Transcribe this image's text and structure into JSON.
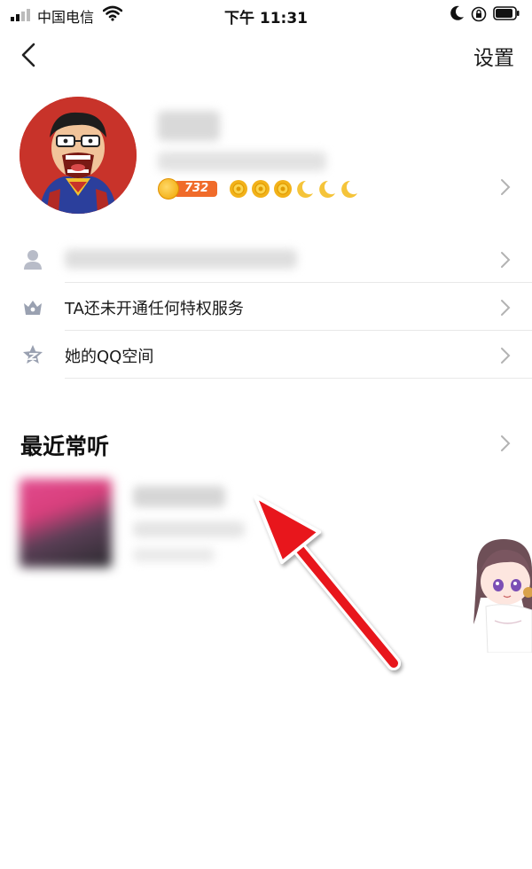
{
  "status_bar": {
    "carrier": "中国电信",
    "time": "下午 11:31"
  },
  "nav": {
    "back_icon": "chevron-left-icon",
    "settings_label": "设置"
  },
  "profile": {
    "level": "732",
    "level_icons": [
      "sun-icon",
      "sun-icon",
      "sun-icon",
      "moon-icon",
      "moon-icon",
      "moon-icon"
    ],
    "accent_color": "#f06b2a"
  },
  "rows": [
    {
      "icon": "person-icon",
      "label": ""
    },
    {
      "icon": "crown-icon",
      "label": "TA还未开通任何特权服务"
    },
    {
      "icon": "qzone-star-icon",
      "label": "她的QQ空间"
    }
  ],
  "recent": {
    "title": "最近常听"
  }
}
